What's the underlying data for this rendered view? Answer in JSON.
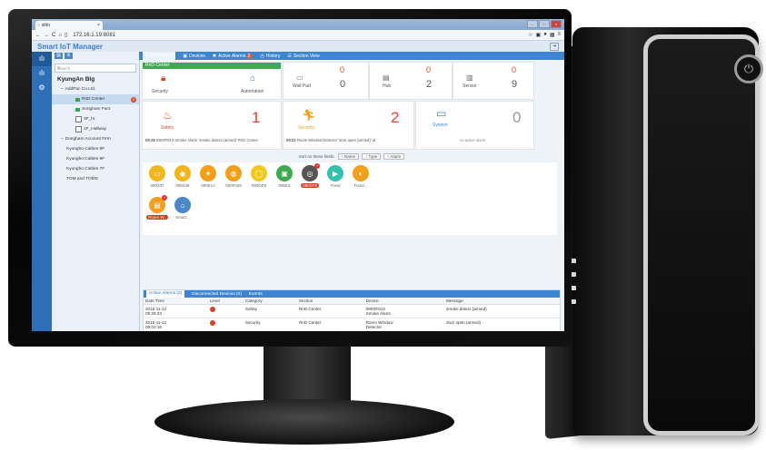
{
  "browser": {
    "tab_title": "sitto",
    "url": "172.16.1.19:8081",
    "win_min": "–",
    "win_max": "□",
    "win_close": "×"
  },
  "app": {
    "title": "Smart IoT Manager",
    "logout": "⇥"
  },
  "rail": [
    "ℑ",
    "≡",
    "⚙"
  ],
  "tree": {
    "search_placeholder": "Search",
    "root": "KyungAn Blg",
    "nodes": [
      {
        "label": "AddPac Co.Ltd.",
        "type": "company"
      },
      {
        "label": "RnD Center",
        "type": "folder",
        "badge": "2"
      },
      {
        "label": "Songham Fact",
        "type": "folder"
      },
      {
        "label": "3F_hr",
        "type": "box"
      },
      {
        "label": "1F_Hallway",
        "type": "box"
      },
      {
        "label": "Dongham Account Firm",
        "type": "company"
      },
      {
        "label": "Kyungho Cables 8F",
        "type": "company"
      },
      {
        "label": "Kyungho Cables 9F",
        "type": "company"
      },
      {
        "label": "Kyungho Cables 7F",
        "type": "company"
      },
      {
        "label": "TOM and TOMS",
        "type": "company"
      }
    ]
  },
  "tabs": {
    "dashboard": "Dashboard",
    "devices": "Devices",
    "active_alarms": "Active Alarms",
    "active_alarms_count": "2",
    "history": "History",
    "section_view": "Section View"
  },
  "rnd": {
    "header": "RnD Center",
    "security": "Security",
    "automation": "Automation"
  },
  "counters": [
    {
      "label": "Wall Pad",
      "alarm": "0",
      "total": "0"
    },
    {
      "label": "Hub",
      "alarm": "0",
      "total": "2"
    },
    {
      "label": "Sensor",
      "alarm": "0",
      "total": "9"
    }
  ],
  "status": {
    "safety_label": "Safety",
    "safety_count": "1",
    "safety_time": "09:28",
    "safety_msg": "090SF813 Smoke Alarm 'smoke detect (armed)' RnD Center",
    "security_label": "Security",
    "security_count": "2",
    "security_time": "09:22",
    "security_msg": "Room Window Detector 'door open (armed)' at",
    "system_label": "System",
    "system_count": "0",
    "system_msg": "no active alarm"
  },
  "sort": {
    "label": "Sort on these fields:",
    "name": "↑ Name",
    "type": "↑ Type",
    "alarm": "↑ Alarm"
  },
  "devices": [
    {
      "label": "090337",
      "color": "#f2b51c",
      "icon": "▭"
    },
    {
      "label": "090438",
      "color": "#f2b51c",
      "icon": "◉"
    },
    {
      "label": "090Eco",
      "color": "#f2a01c",
      "icon": "✦"
    },
    {
      "label": "090F028",
      "color": "#f2a01c",
      "icon": "◍"
    },
    {
      "label": "090DE9",
      "color": "#f2c81c",
      "icon": "◯"
    },
    {
      "label": "090E2",
      "color": "#3eaa50",
      "icon": "▣"
    },
    {
      "label": "090SF8",
      "color": "#555555",
      "icon": "◎",
      "alert": true
    },
    {
      "label": "Fixed",
      "color": "#35c0b0",
      "icon": "▶"
    },
    {
      "label": "Fixed...",
      "color": "#f2a01c",
      "icon": "◐"
    },
    {
      "label": "Room W..",
      "color": "#f2a01c",
      "icon": "▤",
      "alert": true
    },
    {
      "label": "Smart...",
      "color": "#4a86c8",
      "icon": "⌂"
    }
  ],
  "bottom": {
    "tab_active": "Active Alarms (2)",
    "tab_disconnected": "Disconnected Devices (0)",
    "tab_events": "Events",
    "columns": [
      "Date Time",
      "Level",
      "Category",
      "Section",
      "Device",
      "Message"
    ],
    "rows": [
      {
        "date": "2015-11-12",
        "time": "09:28:33",
        "category": "Safety",
        "section": "RnD Center",
        "device": "090SF813",
        "device2": "Smoke Alarm",
        "message": "smoke detect (armed)"
      },
      {
        "date": "2015-11-12",
        "time": "09:02:16",
        "category": "Security",
        "section": "RnD Center",
        "device": "Room Window",
        "device2": "Detector",
        "message": "door open (armed)"
      }
    ]
  },
  "colors": {
    "accent": "#3e85d1",
    "red": "#e3432a",
    "orange": "#f2a01c",
    "green": "#3eaa50"
  }
}
